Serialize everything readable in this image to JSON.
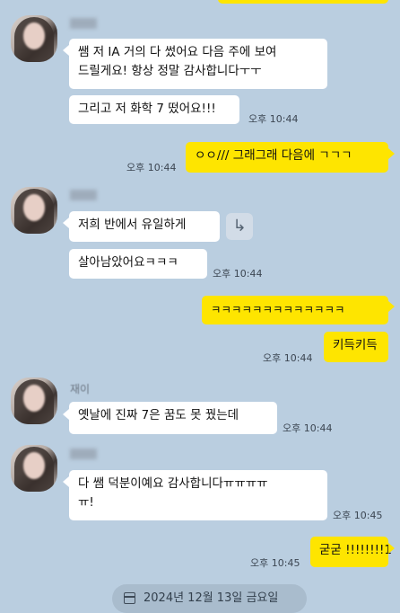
{
  "colors": {
    "background": "#bacee0",
    "incoming_bubble": "#ffffff",
    "outgoing_bubble": "#fee500",
    "date_pill": "#a9bccd"
  },
  "icons": {
    "share": "share-icon",
    "calendar": "calendar-icon"
  },
  "messages": [
    {
      "id": "m1",
      "direction": "in",
      "text_lines": [
        "쌤 저 IA 거의 다 썼어요 다음 주에 보여",
        "드릴게요! 항상 정말 감사합니다ㅜㅜ"
      ],
      "time": ""
    },
    {
      "id": "m2",
      "direction": "in",
      "text": "그리고 저 화학 7 떴어요!!!",
      "time": "오후 10:44"
    },
    {
      "id": "m3",
      "direction": "out",
      "text": "ㅇㅇ/// 그래그래 다음에 ㄱㄱㄱ",
      "time": "오후 10:44"
    },
    {
      "id": "m4",
      "direction": "in",
      "text": "저희 반에서 유일하게",
      "time": ""
    },
    {
      "id": "m5",
      "direction": "in",
      "text": "살아남았어요ㅋㅋㅋ",
      "time": "오후 10:44"
    },
    {
      "id": "m6",
      "direction": "out",
      "text": "ㅋㅋㅋㅋㅋㅋㅋㅋㅋㅋㅋㅋㅋ",
      "time": ""
    },
    {
      "id": "m7",
      "direction": "out",
      "text": "키득키득",
      "time": "오후 10:44"
    },
    {
      "id": "m8",
      "direction": "in",
      "sender_partial": "재이",
      "text": "옛날에 진짜 7은 꿈도 못 꿨는데",
      "time": "오후 10:44"
    },
    {
      "id": "m9",
      "direction": "in",
      "text_lines": [
        "다 쌤 덕분이예요 감사합니다ㅠㅠㅠㅠ",
        "ㅠ!"
      ],
      "time": "오후 10:45"
    },
    {
      "id": "m10",
      "direction": "out",
      "text": "굳굳 !!!!!!!!1",
      "time": "오후 10:45"
    }
  ],
  "date_divider": "2024년 12월 13일 금요일"
}
